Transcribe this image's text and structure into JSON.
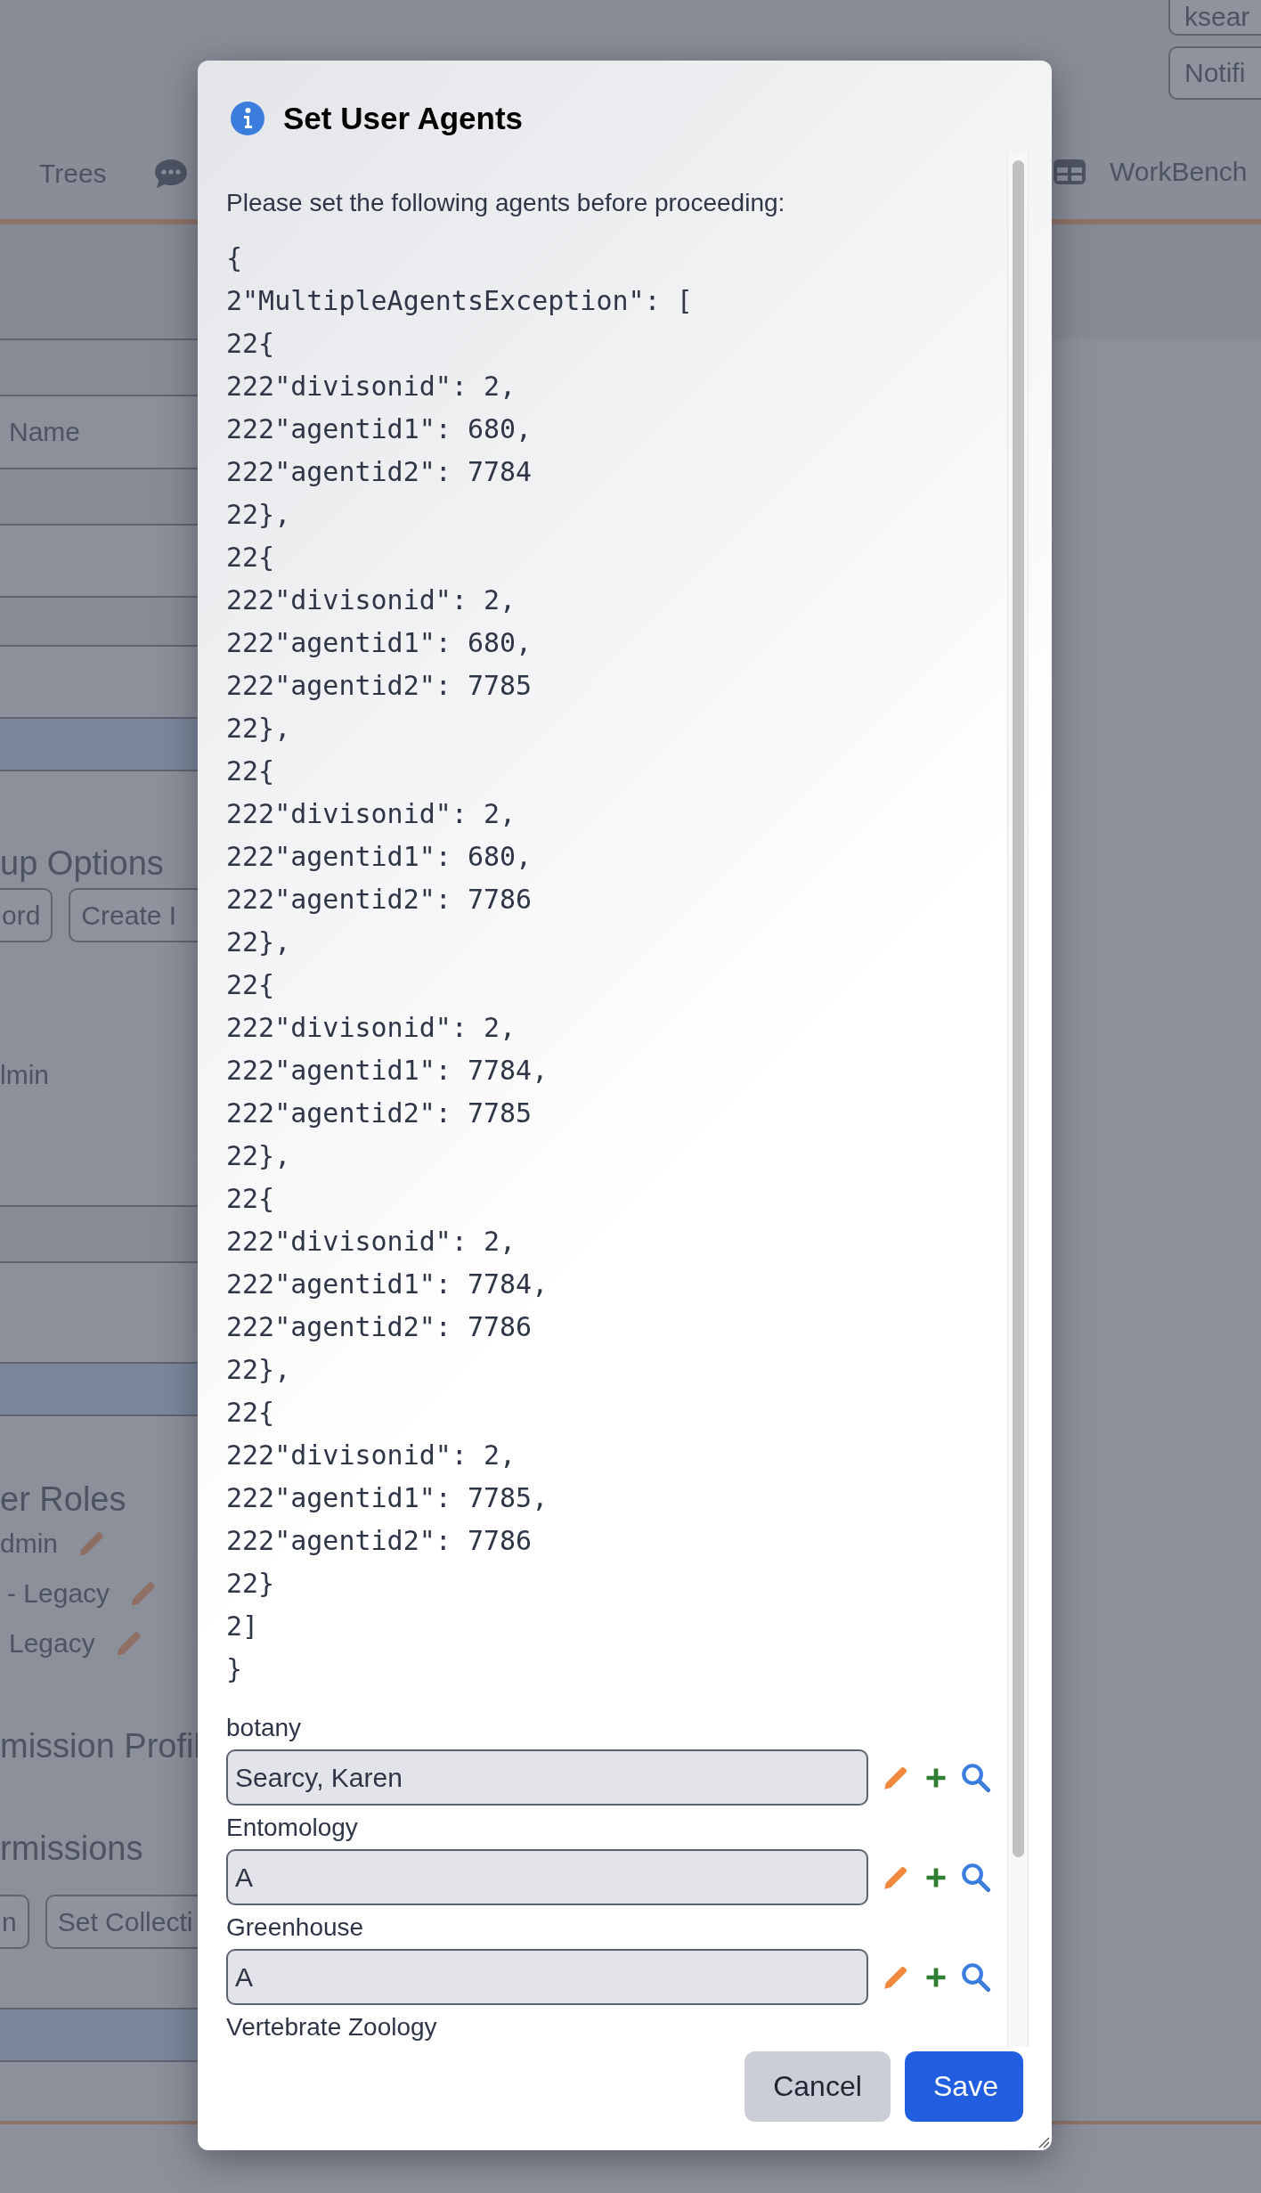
{
  "background": {
    "header_buttons": [
      "ksear",
      "Notifi"
    ],
    "nav_left": "Trees",
    "nav_right": "WorkBench",
    "name_label": "Name",
    "group_options": {
      "heading": "up Options",
      "buttons": [
        "ord",
        "Create I"
      ]
    },
    "admin_label": "lmin",
    "user_roles": {
      "heading": "er Roles",
      "roles": [
        "dmin",
        "- Legacy",
        "Legacy"
      ]
    },
    "permission_profile_heading": "mission Profil",
    "permissions": {
      "heading": "rmissions",
      "buttons": [
        "n",
        "Set Collecti"
      ]
    }
  },
  "dialog": {
    "title": "Set User Agents",
    "message": "Please set the following agents before proceeding:",
    "details": [
      "{",
      "2\"MultipleAgentsException\": [",
      "22{",
      "222\"divisonid\": 2,",
      "222\"agentid1\": 680,",
      "222\"agentid2\": 7784",
      "22},",
      "22{",
      "222\"divisonid\": 2,",
      "222\"agentid1\": 680,",
      "222\"agentid2\": 7785",
      "22},",
      "22{",
      "222\"divisonid\": 2,",
      "222\"agentid1\": 680,",
      "222\"agentid2\": 7786",
      "22},",
      "22{",
      "222\"divisonid\": 2,",
      "222\"agentid1\": 7784,",
      "222\"agentid2\": 7785",
      "22},",
      "22{",
      "222\"divisonid\": 2,",
      "222\"agentid1\": 7784,",
      "222\"agentid2\": 7786",
      "22},",
      "22{",
      "222\"divisonid\": 2,",
      "222\"agentid1\": 7785,",
      "222\"agentid2\": 7786",
      "22}",
      "2]",
      "}"
    ],
    "agents": [
      {
        "collection": "botany",
        "value": "Searcy, Karen"
      },
      {
        "collection": "Entomology",
        "value": "A"
      },
      {
        "collection": "Greenhouse",
        "value": "A"
      },
      {
        "collection": "Vertebrate Zoology"
      }
    ],
    "buttons": [
      {
        "label": "Cancel",
        "kind": "secondary"
      },
      {
        "label": "Save",
        "kind": "primary"
      }
    ]
  }
}
